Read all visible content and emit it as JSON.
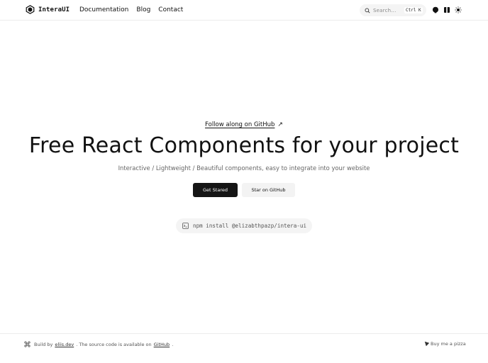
{
  "header": {
    "brand": "InteraUI",
    "nav": [
      "Documentation",
      "Blog",
      "Contact"
    ],
    "search_placeholder": "Search...",
    "shortcut_keys": [
      "Ctrl",
      "K"
    ],
    "icons": [
      "github-icon",
      "panel-icon",
      "sun-icon"
    ]
  },
  "hero": {
    "follow_link": "Follow along on GitHub",
    "follow_arrow": "↗",
    "title": "Free React Components for your project",
    "subtitle": "Interactive / Lightweight / Beautiful components, easy to integrate into your website",
    "primary_button": "Get Stared",
    "secondary_button": "Star on GitHub",
    "install_command": "npm install @elizabthpazp/intera-ui"
  },
  "footer": {
    "build_prefix": "Build by",
    "author_link": "eliis.dev",
    "source_text": ". The source code is available on",
    "source_link": "GitHub",
    "end_punct": ".",
    "pizza": "Buy me a pizza"
  },
  "colors": {
    "primary_button": "#151515",
    "secondary_button": "#f3f3f3",
    "muted_text": "#666666",
    "border": "#ececec"
  }
}
